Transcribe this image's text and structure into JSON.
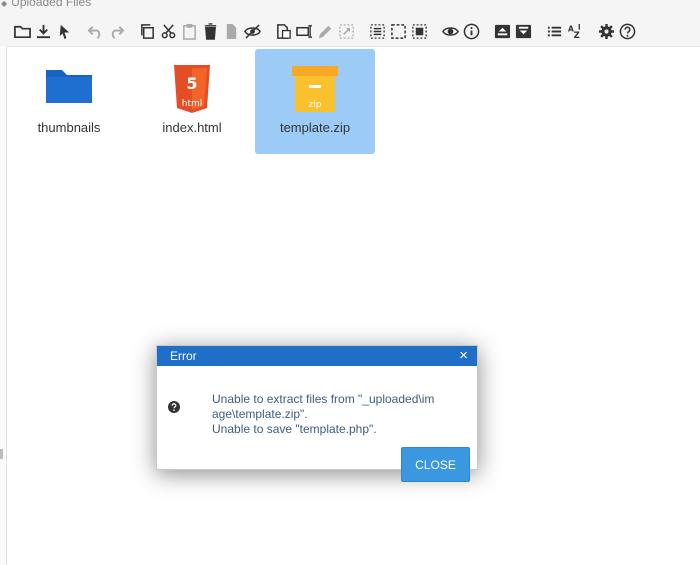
{
  "header": {
    "title": "Uploaded Files"
  },
  "toolbar": {
    "buttons": [
      "folder-icon",
      "download-icon",
      "pointer-icon",
      "undo-icon",
      "redo-icon",
      "copy-icon",
      "cut-icon",
      "paste-icon",
      "delete-icon",
      "file-icon",
      "hide-icon",
      "duplicate-icon",
      "rename-icon",
      "edit-icon",
      "resize-icon",
      "select-all-icon",
      "select-none-icon",
      "invert-select-icon",
      "view-icon",
      "info-icon",
      "upload-archive-icon",
      "extract-archive-icon",
      "list-view-icon",
      "sort-icon",
      "settings-icon",
      "help-icon"
    ]
  },
  "files": [
    {
      "name": "thumbnails",
      "type": "folder",
      "selected": false
    },
    {
      "name": "index.html",
      "type": "html",
      "badge": "html",
      "selected": false
    },
    {
      "name": "template.zip",
      "type": "zip",
      "badge": "zip",
      "selected": true
    }
  ],
  "dialog": {
    "title": "Error",
    "close_glyph": "×",
    "message_line1": "Unable to extract files from \"_uploaded\\image\\template.zip\".",
    "message_line2": "Unable to save \"template.php\".",
    "button_label": "CLOSE"
  },
  "colors": {
    "accent": "#1f6fc6",
    "button": "#3b98e0",
    "selection": "#9dcbf7",
    "folder": "#1565c0",
    "html": "#e44d26",
    "zip": "#fbc02d"
  }
}
